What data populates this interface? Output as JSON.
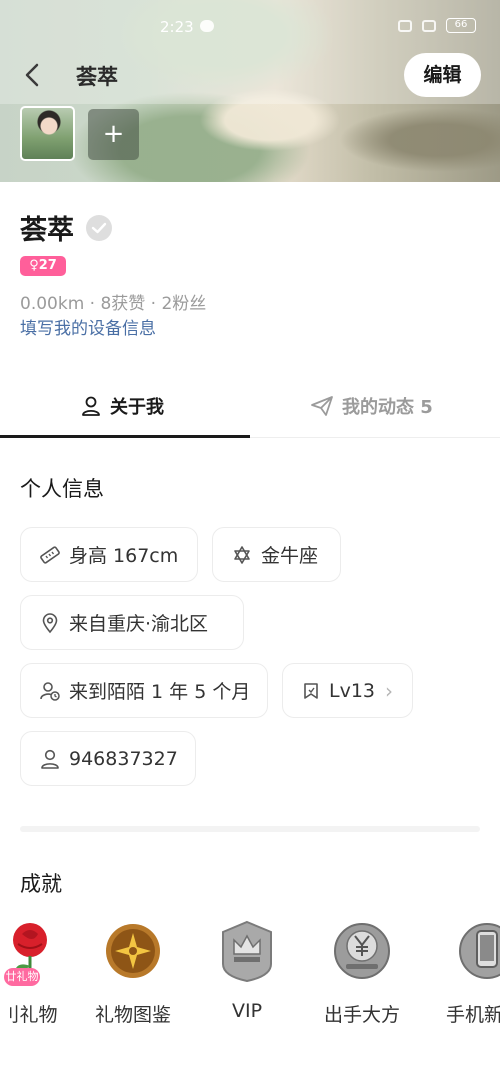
{
  "status_bar": {
    "time": "2:23",
    "battery": "66"
  },
  "header": {
    "title": "荟萃",
    "edit_label": "编辑",
    "add_photo_symbol": "+"
  },
  "profile": {
    "name": "荟萃",
    "age_badge": "♀27",
    "stats": "0.00km · 8获赞 · 2粉丝",
    "device_link": "填写我的设备信息"
  },
  "tabs": {
    "about": "关于我",
    "moments": "我的动态 5"
  },
  "info": {
    "title": "个人信息",
    "chips": [
      {
        "label": "身高 167cm",
        "icon": "ruler-icon"
      },
      {
        "label": "金牛座",
        "icon": "star-of-david-icon"
      },
      {
        "label": "来自重庆·渝北区",
        "icon": "location-pin-icon"
      },
      {
        "label": "来到陌陌 1 年 5 个月",
        "icon": "user-clock-icon"
      },
      {
        "label": "Lv13",
        "icon": "bookmark-icon"
      },
      {
        "label": "946837327",
        "icon": "user-icon"
      }
    ]
  },
  "achievements": {
    "title": "成就",
    "items": [
      {
        "label": "刂礼物",
        "badge": "廿礼物",
        "icon": "rose-icon"
      },
      {
        "label": "礼物图鉴",
        "icon": "gold-compass-medal-icon"
      },
      {
        "label": "VIP",
        "icon": "crown-medal-icon"
      },
      {
        "label": "出手大方",
        "icon": "yuan-medal-icon"
      },
      {
        "label": "手机新",
        "icon": "phone-medal-icon"
      }
    ]
  },
  "colors": {
    "accent_pink": "#ff5f9a",
    "link_blue": "#4a6fa5",
    "muted_gray": "#9b9b9b"
  }
}
